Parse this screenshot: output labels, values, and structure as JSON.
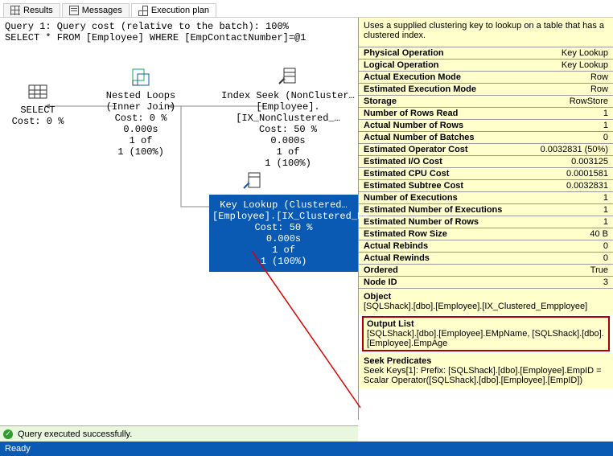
{
  "tabs": {
    "results": "Results",
    "messages": "Messages",
    "plan": "Execution plan"
  },
  "header": {
    "line1": "Query 1: Query cost (relative to the batch): 100%",
    "line2": "SELECT * FROM [Employee] WHERE [EmpContactNumber]=@1"
  },
  "nodes": {
    "select": {
      "title": "SELECT",
      "cost": "Cost: 0 %"
    },
    "nested": {
      "title": "Nested Loops",
      "sub": "(Inner Join)",
      "cost": "Cost: 0 %",
      "time": "0.000s",
      "rows1": "1 of",
      "rows2": "1 (100%)"
    },
    "seek": {
      "title": "Index Seek (NonCluster…",
      "sub": "[Employee].[IX_NonClustered_…",
      "cost": "Cost: 50 %",
      "time": "0.000s",
      "rows1": "1 of",
      "rows2": "1 (100%)"
    },
    "lookup": {
      "title": "Key Lookup (Clustered…",
      "sub": "[Employee].[IX_Clustered_Em…",
      "cost": "Cost: 50 %",
      "time": "0.000s",
      "rows1": "1 of",
      "rows2": "1 (100%)"
    }
  },
  "rp_desc": "Uses a supplied clustering key to lookup on a table that has a clustered index.",
  "props": [
    {
      "k": "Physical Operation",
      "v": "Key Lookup"
    },
    {
      "k": "Logical Operation",
      "v": "Key Lookup"
    },
    {
      "k": "Actual Execution Mode",
      "v": "Row"
    },
    {
      "k": "Estimated Execution Mode",
      "v": "Row"
    },
    {
      "k": "Storage",
      "v": "RowStore"
    },
    {
      "k": "Number of Rows Read",
      "v": "1"
    },
    {
      "k": "Actual Number of Rows",
      "v": "1"
    },
    {
      "k": "Actual Number of Batches",
      "v": "0"
    },
    {
      "k": "Estimated Operator Cost",
      "v": "0.0032831 (50%)"
    },
    {
      "k": "Estimated I/O Cost",
      "v": "0.003125"
    },
    {
      "k": "Estimated CPU Cost",
      "v": "0.0001581"
    },
    {
      "k": "Estimated Subtree Cost",
      "v": "0.0032831"
    },
    {
      "k": "Number of Executions",
      "v": "1"
    },
    {
      "k": "Estimated Number of Executions",
      "v": "1"
    },
    {
      "k": "Estimated Number of Rows",
      "v": "1"
    },
    {
      "k": "Estimated Row Size",
      "v": "40 B"
    },
    {
      "k": "Actual Rebinds",
      "v": "0"
    },
    {
      "k": "Actual Rewinds",
      "v": "0"
    },
    {
      "k": "Ordered",
      "v": "True"
    },
    {
      "k": "Node ID",
      "v": "3"
    }
  ],
  "object": {
    "h": "Object",
    "v": "[SQLShack].[dbo].[Employee].[IX_Clustered_Empployee]"
  },
  "output": {
    "h": "Output List",
    "v": "[SQLShack].[dbo].[Employee].EMpName, [SQLShack].[dbo].[Employee].EmpAge"
  },
  "seekp": {
    "h": "Seek Predicates",
    "v": "Seek Keys[1]: Prefix: [SQLShack].[dbo].[Employee].EmpID = Scalar Operator([SQLShack].[dbo].[Employee].[EmpID])"
  },
  "status": "Query executed successfully.",
  "ready": "Ready"
}
